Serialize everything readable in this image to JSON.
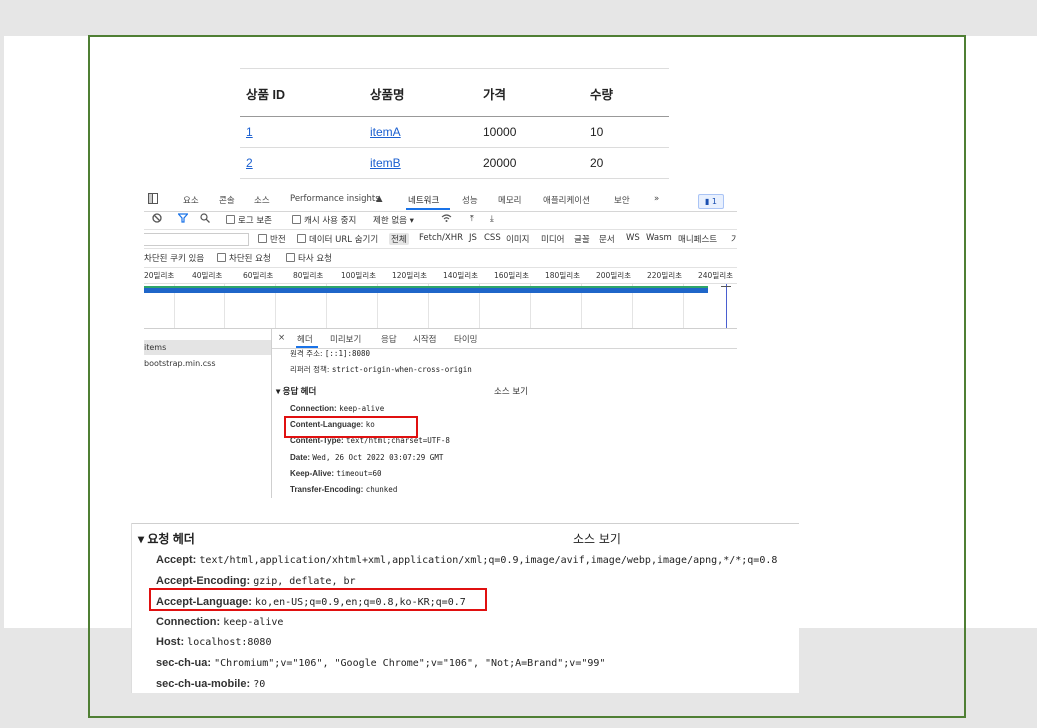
{
  "product_table": {
    "headers": [
      "상품 ID",
      "상품명",
      "가격",
      "수량"
    ],
    "rows": [
      {
        "id": "1",
        "name": "itemA",
        "price": "10000",
        "qty": "10"
      },
      {
        "id": "2",
        "name": "itemB",
        "price": "20000",
        "qty": "20"
      }
    ]
  },
  "devtools": {
    "tabs": [
      "요소",
      "콘솔",
      "소스",
      "Performance insights",
      "네트워크",
      "성능",
      "메모리",
      "애플리케이션",
      "보안",
      "»"
    ],
    "message_count": "1",
    "toolbar": {
      "preserve_log": "로그 보존",
      "disable_cache": "캐시 사용 중지",
      "throttle": "제한 없음"
    },
    "filter_row": {
      "invert": "반전",
      "hide_data_urls": "데이터 URL 숨기기",
      "types": [
        "전체",
        "Fetch/XHR",
        "JS",
        "CSS",
        "이미지",
        "미디어",
        "글꼴",
        "문서",
        "WS",
        "Wasm",
        "매니페스트",
        "기"
      ]
    },
    "cookie_row": {
      "blocked_cookies": "차단된 쿠키 있음",
      "blocked_requests": "차단된 요청",
      "third_party": "타사 요청"
    },
    "timeline_ticks": [
      "20밀리초",
      "40밀리초",
      "60밀리초",
      "80밀리초",
      "100밀리초",
      "120밀리초",
      "140밀리초",
      "160밀리초",
      "180밀리초",
      "200밀리초",
      "220밀리초",
      "240밀리초"
    ],
    "requests": [
      "items",
      "bootstrap.min.css"
    ],
    "detail_tabs": [
      "×",
      "헤더",
      "미리보기",
      "응답",
      "시작점",
      "타이밍"
    ],
    "general": [
      {
        "label": "원격 주소:",
        "value": "[::1]:8080"
      },
      {
        "label": "리퍼러 정책:",
        "value": "strict-origin-when-cross-origin"
      }
    ],
    "response_section": "▾ 응답 헤더",
    "view_source": "소스 보기",
    "response_headers": [
      {
        "name": "Connection:",
        "value": "keep-alive"
      },
      {
        "name": "Content-Language:",
        "value": "ko"
      },
      {
        "name": "Content-Type:",
        "value": "text/html;charset=UTF-8"
      },
      {
        "name": "Date:",
        "value": "Wed, 26 Oct 2022 03:07:29 GMT"
      },
      {
        "name": "Keep-Alive:",
        "value": "timeout=60"
      },
      {
        "name": "Transfer-Encoding:",
        "value": "chunked"
      }
    ]
  },
  "request_headers": {
    "section": "▾ 요청 헤더",
    "view_source": "소스 보기",
    "items": [
      {
        "name": "Accept:",
        "value": "text/html,application/xhtml+xml,application/xml;q=0.9,image/avif,image/webp,image/apng,*/*;q=0.8"
      },
      {
        "name": "Accept-Encoding:",
        "value": "gzip, deflate, br"
      },
      {
        "name": "Accept-Language:",
        "value": "ko,en-US;q=0.9,en;q=0.8,ko-KR;q=0.7"
      },
      {
        "name": "Connection:",
        "value": "keep-alive"
      },
      {
        "name": "Host:",
        "value": "localhost:8080"
      },
      {
        "name": "sec-ch-ua:",
        "value": "\"Chromium\";v=\"106\", \"Google Chrome\";v=\"106\", \"Not;A=Brand\";v=\"99\""
      },
      {
        "name": "sec-ch-ua-mobile:",
        "value": "?0"
      }
    ]
  },
  "colors": {
    "frame": "#4f7f34",
    "highlight": "#e01010",
    "link": "#1a5fd0",
    "active_tab": "#1a73e8"
  }
}
